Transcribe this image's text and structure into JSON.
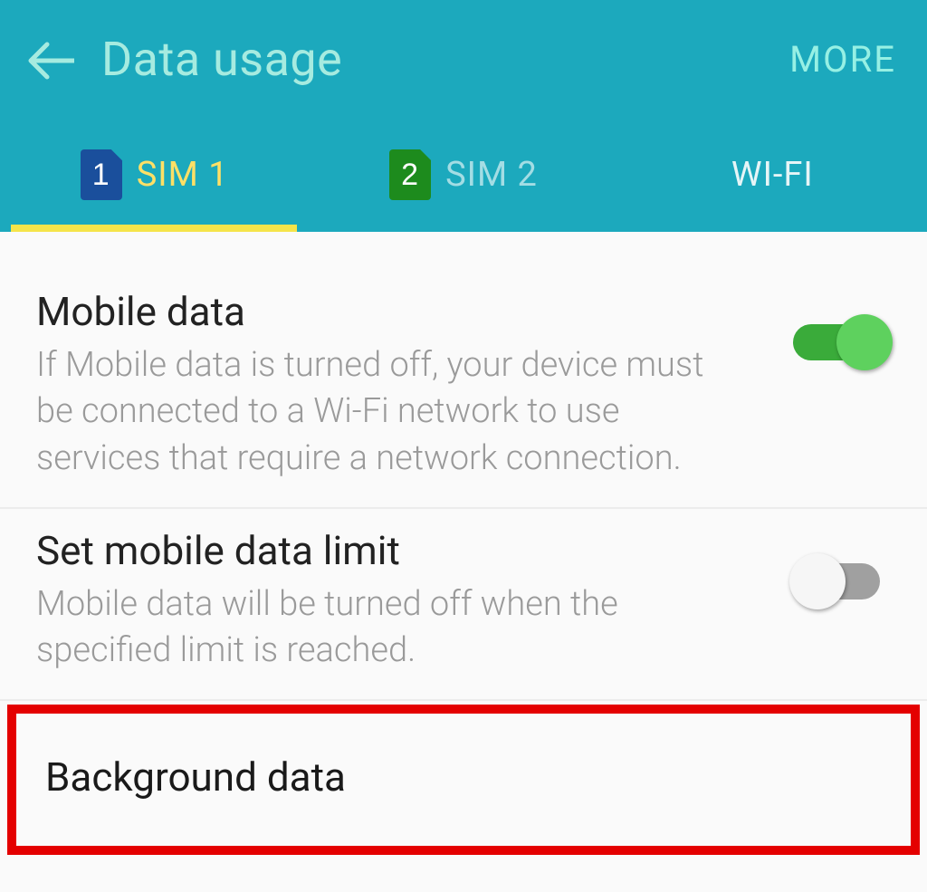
{
  "appbar": {
    "title": "Data usage",
    "more_label": "MORE"
  },
  "tabs": {
    "sim1_label": "SIM 1",
    "sim1_num": "1",
    "sim2_label": "SIM 2",
    "sim2_num": "2",
    "wifi_label": "WI-FI",
    "active_index": 0
  },
  "settings": {
    "mobile_data": {
      "title": "Mobile data",
      "desc": "If Mobile data is turned off, your device must be connected to a Wi-Fi network to use services that require a network connection.",
      "enabled": true
    },
    "data_limit": {
      "title": "Set mobile data limit",
      "desc": "Mobile data will be turned off when the specified limit is reached.",
      "enabled": false
    },
    "background_data": {
      "title": "Background data"
    }
  }
}
